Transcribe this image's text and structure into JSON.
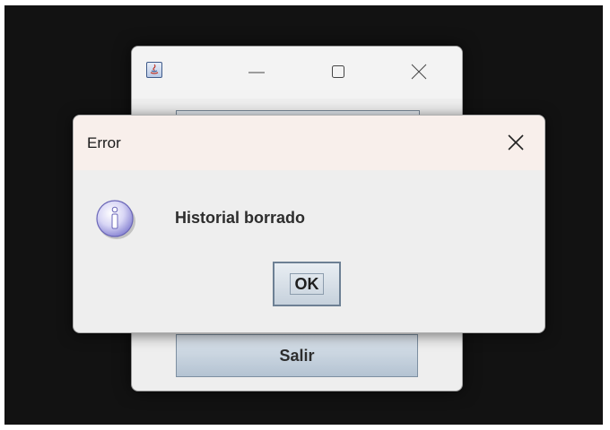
{
  "parent_window": {
    "icon": "java-cup-icon",
    "controls": [
      "minimize-icon",
      "maximize-icon",
      "close-icon"
    ],
    "exit_button_label": "Salir"
  },
  "dialog": {
    "title": "Error",
    "icon": "information-icon",
    "message": "Historial borrado",
    "ok_label": "OK",
    "close_icon": "close-icon"
  },
  "colors": {
    "background": "#121212",
    "dialog_titlebar": "#f8efeb",
    "window_body": "#eeeeee",
    "button_border": "#6d8094"
  }
}
